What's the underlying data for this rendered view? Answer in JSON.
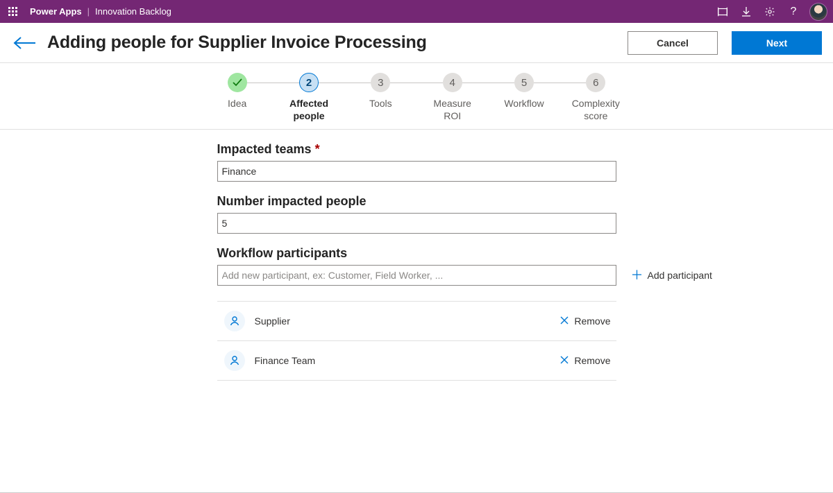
{
  "colors": {
    "brand": "#742774",
    "primary": "#0078d4"
  },
  "suitebar": {
    "product": "Power Apps",
    "app": "Innovation Backlog"
  },
  "header": {
    "title": "Adding people for Supplier Invoice Processing",
    "cancel": "Cancel",
    "next": "Next"
  },
  "stepper": {
    "steps": [
      {
        "label": "Idea",
        "state": "done",
        "num": "✓"
      },
      {
        "label": "Affected people",
        "state": "active",
        "num": "2"
      },
      {
        "label": "Tools",
        "state": "future",
        "num": "3"
      },
      {
        "label": "Measure ROI",
        "state": "future",
        "num": "4"
      },
      {
        "label": "Workflow",
        "state": "future",
        "num": "5"
      },
      {
        "label": "Complexity score",
        "state": "future",
        "num": "6"
      }
    ]
  },
  "form": {
    "teams_label": "Impacted teams",
    "teams_required_mark": "*",
    "teams_value": "Finance",
    "people_label": "Number impacted people",
    "people_value": "5",
    "participants_label": "Workflow participants",
    "participants_placeholder": "Add new participant, ex: Customer, Field Worker, ...",
    "add_participant": "Add participant",
    "remove_label": "Remove",
    "participants": [
      {
        "name": "Supplier"
      },
      {
        "name": "Finance Team"
      }
    ]
  }
}
